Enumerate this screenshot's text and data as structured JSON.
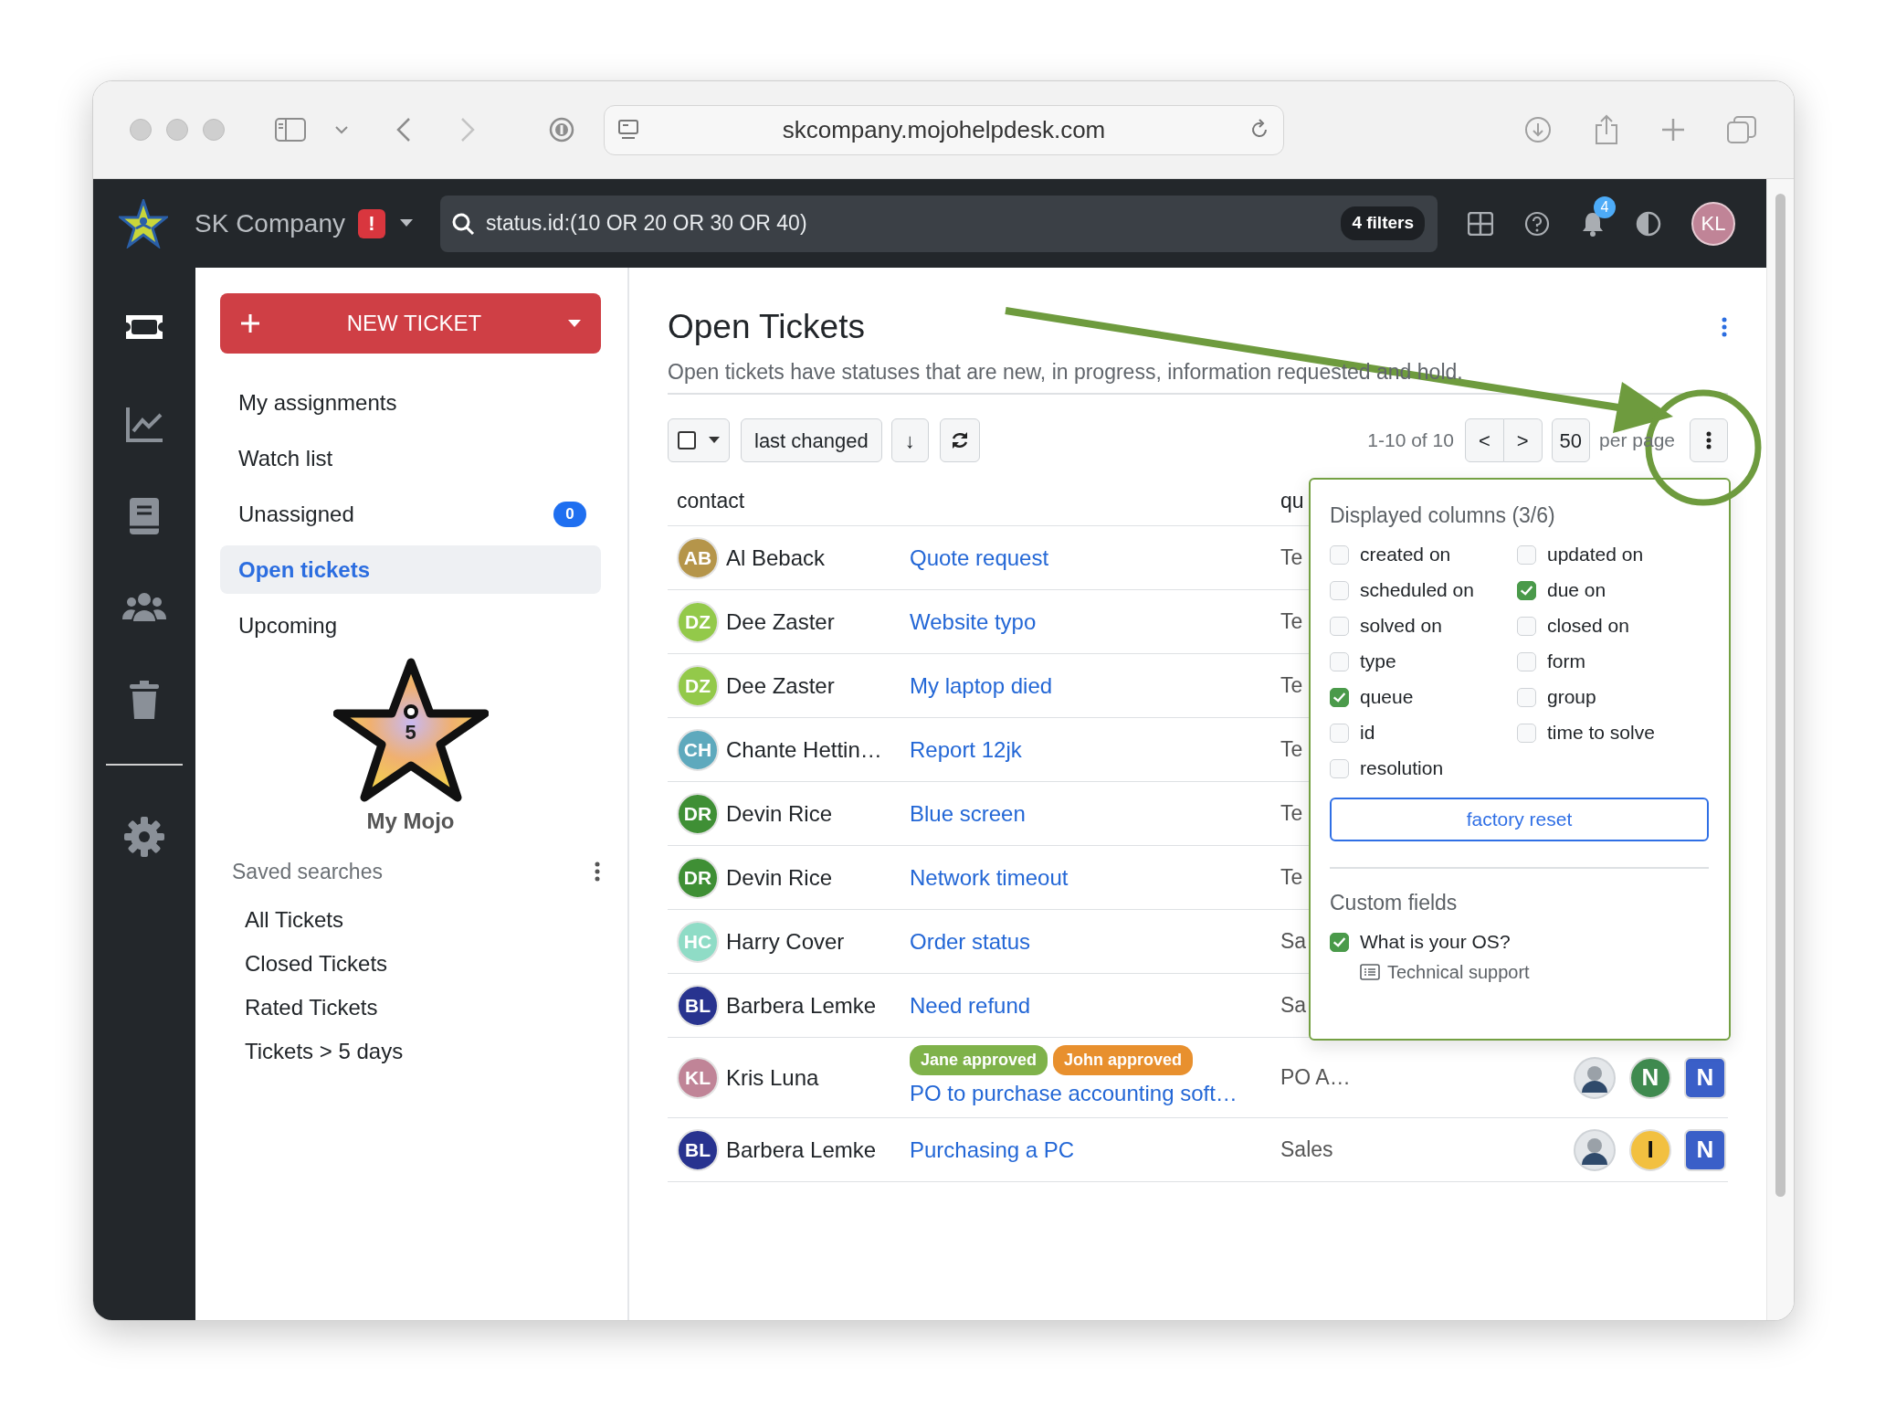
{
  "browser": {
    "url": "skcompany.mojohelpdesk.com"
  },
  "header": {
    "company": "SK Company",
    "alert": "!",
    "search": "status.id:(10 OR 20 OR 30 OR 40)",
    "filters": "4 filters",
    "notifications": "4",
    "user_initials": "KL"
  },
  "rail": [
    {
      "kind": "tickets",
      "selected": true
    },
    {
      "kind": "analytics",
      "selected": false
    },
    {
      "kind": "knowledge",
      "selected": false
    },
    {
      "kind": "people",
      "selected": false
    },
    {
      "kind": "trash",
      "selected": false
    },
    {
      "kind": "settings",
      "selected": false
    }
  ],
  "sidebar": {
    "new_ticket": "NEW TICKET",
    "nav": [
      {
        "label": "My assignments",
        "selected": false
      },
      {
        "label": "Watch list",
        "selected": false
      },
      {
        "label": "Unassigned",
        "selected": false,
        "count": "0"
      },
      {
        "label": "Open tickets",
        "selected": true
      },
      {
        "label": "Upcoming",
        "selected": false
      }
    ],
    "mojo": {
      "score": "5",
      "label": "My Mojo"
    },
    "saved_searches": {
      "title": "Saved searches",
      "items": [
        "All Tickets",
        "Closed Tickets",
        "Rated Tickets",
        "Tickets > 5 days"
      ]
    }
  },
  "main": {
    "title": "Open Tickets",
    "description": "Open tickets have statuses that are new, in progress, information requested and hold.",
    "toolbar": {
      "sort": "last changed",
      "direction": "↓",
      "range": "1-10 of 10",
      "prev": "<",
      "next": ">",
      "per_page": "50",
      "per_page_label": "per page"
    },
    "columns": [
      "contact",
      "qu"
    ],
    "rows": [
      {
        "initials": "AB",
        "contact": "Al Beback",
        "color": "#b5954a",
        "subject": "Quote request",
        "queue": "Te"
      },
      {
        "initials": "DZ",
        "contact": "Dee Zaster",
        "color": "#93c94a",
        "subject": "Website typo",
        "queue": "Te"
      },
      {
        "initials": "DZ",
        "contact": "Dee Zaster",
        "color": "#93c94a",
        "subject": "My laptop died",
        "queue": "Te"
      },
      {
        "initials": "CH",
        "contact": "Chante Hettin…",
        "color": "#5ea9bd",
        "subject": "Report 12jk",
        "queue": "Te"
      },
      {
        "initials": "DR",
        "contact": "Devin Rice",
        "color": "#3f8f35",
        "subject": "Blue screen",
        "queue": "Te"
      },
      {
        "initials": "DR",
        "contact": "Devin Rice",
        "color": "#3f8f35",
        "subject": "Network timeout",
        "queue": "Te"
      },
      {
        "initials": "HC",
        "contact": "Harry Cover",
        "color": "#8fdcc6",
        "subject": "Order status",
        "queue": "Sa"
      },
      {
        "initials": "BL",
        "contact": "Barbera Lemke",
        "color": "#28338f",
        "subject": "Need refund",
        "queue": "Sa"
      },
      {
        "initials": "KL",
        "contact": "Kris Luna",
        "color": "#c08497",
        "subject": "PO to purchase accounting soft…",
        "queue": "PO A…",
        "tags": [
          {
            "label": "Jane approved",
            "color": "#7fb24a"
          },
          {
            "label": "John approved",
            "color": "#e8902e"
          }
        ],
        "assignees": [
          {
            "kind": "photo"
          },
          {
            "kind": "agent",
            "label": "N",
            "color": "#3f8a4f"
          },
          {
            "kind": "group",
            "label": "N",
            "color": "#3a5fc8"
          }
        ]
      },
      {
        "initials": "BL",
        "contact": "Barbera Lemke",
        "color": "#28338f",
        "subject": "Purchasing a PC",
        "queue": "Sales",
        "assignees": [
          {
            "kind": "photo"
          },
          {
            "kind": "agent",
            "label": "I",
            "color": "#f2c040"
          },
          {
            "kind": "group",
            "label": "N",
            "color": "#3a5fc8"
          }
        ]
      }
    ]
  },
  "column_menu": {
    "title": "Displayed columns (3/6)",
    "options": [
      {
        "label": "created on",
        "checked": false
      },
      {
        "label": "updated on",
        "checked": false
      },
      {
        "label": "scheduled on",
        "checked": false
      },
      {
        "label": "due on",
        "checked": true
      },
      {
        "label": "solved on",
        "checked": false
      },
      {
        "label": "closed on",
        "checked": false
      },
      {
        "label": "type",
        "checked": false
      },
      {
        "label": "form",
        "checked": false
      },
      {
        "label": "queue",
        "checked": true
      },
      {
        "label": "group",
        "checked": false
      },
      {
        "label": "id",
        "checked": false
      },
      {
        "label": "time to solve",
        "checked": false
      },
      {
        "label": "resolution",
        "checked": false
      }
    ],
    "reset": "factory reset",
    "custom_title": "Custom fields",
    "custom": [
      {
        "label": "What is your OS?",
        "checked": true,
        "form": "Technical support"
      }
    ]
  }
}
